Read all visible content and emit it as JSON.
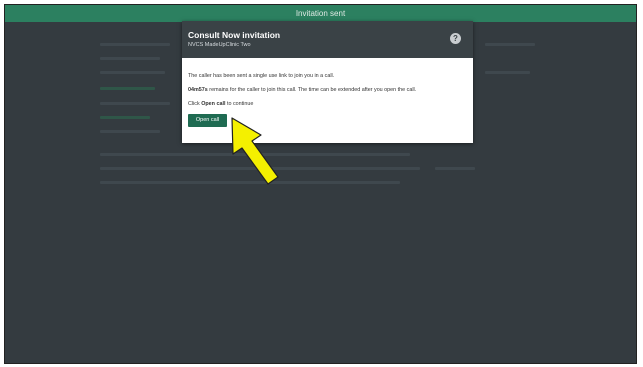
{
  "topbar": {
    "title": "Invitation sent"
  },
  "modal": {
    "title": "Consult Now invitation",
    "subtitle": "NVCS MadeUpClinic Two",
    "help_icon": "?",
    "line1": "The caller has been sent a single use link to join you in a call.",
    "line2_time": "04m57s",
    "line2_rest": " remains for the caller to join this call. The time can be extended after you open the call.",
    "line3_prefix": "Click ",
    "line3_bold": "Open call",
    "line3_suffix": " to continue",
    "open_button": "Open call"
  },
  "colors": {
    "topbar": "#2c8060",
    "background": "#343b40",
    "modal_header": "#3a4246",
    "button": "#1f6b52",
    "arrow": "#f4f000"
  },
  "icons": {
    "help": "help-icon",
    "pointer": "yellow-arrow-icon"
  }
}
